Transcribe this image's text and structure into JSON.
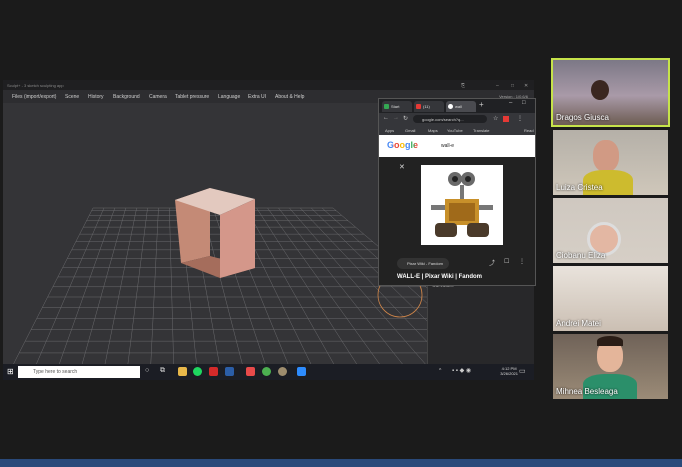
{
  "app": {
    "title": "Sculpt+ - 3 sketch sculpting app",
    "version": "Version : 1/0.6/6",
    "menu": [
      "Files (import/export)",
      "Scene",
      "History",
      "Background",
      "Camera",
      "Tablet pressure",
      "Language",
      "Extra UI",
      "About & Help"
    ],
    "right_panel_label": "Curvature"
  },
  "chrome": {
    "tabs": [
      "Start",
      "(11)",
      "wall"
    ],
    "url": "google.com/search?q...",
    "bookmarks": [
      "Apps",
      "Gmail",
      "Maps",
      "YouTube",
      "Translate",
      "Read"
    ],
    "logo": "Google",
    "query": "wall-e",
    "source_chip": "Pixar Wiki - Fandom",
    "result_title": "WALL-E | Pixar Wiki | Fandom"
  },
  "taskbar": {
    "search_placeholder": "Type here to search",
    "time": "4:12 PM",
    "date": "3/26/2021"
  },
  "participants": [
    {
      "name": "Dragos Giusca"
    },
    {
      "name": "Luiza Cristea"
    },
    {
      "name": "Ciobanu Eliza"
    },
    {
      "name": "Andrei Matei"
    },
    {
      "name": "Mihnea Besleaga"
    }
  ],
  "colors": {
    "active_speaker_border": "#c6e34a",
    "cube": "#d9a08c"
  }
}
